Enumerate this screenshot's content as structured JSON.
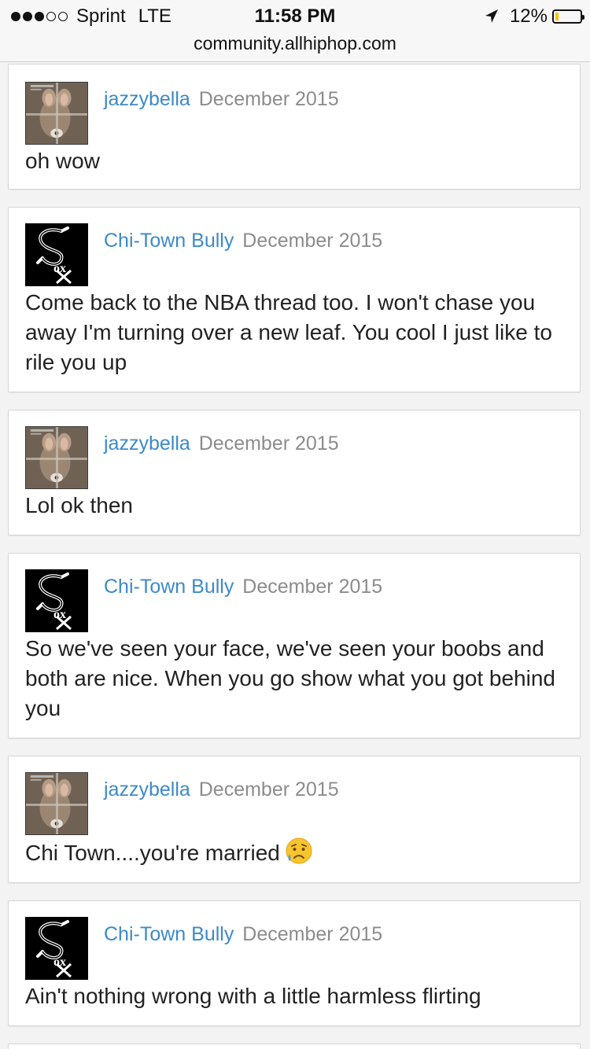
{
  "status_bar": {
    "carrier": "Sprint",
    "network": "LTE",
    "time": "11:58 PM",
    "battery_percent": "12%",
    "battery_level": 0.12,
    "signal_bars_filled": 3,
    "signal_bars_total": 5
  },
  "browser": {
    "url": "community.allhiphop.com"
  },
  "colors": {
    "author_link": "#3c8ac9",
    "date": "#8c8c8c",
    "battery": "#f5c400"
  },
  "posts": [
    {
      "author": "jazzybella",
      "date": "December 2015",
      "body": "oh wow",
      "avatar": "deer-photo-avatar"
    },
    {
      "author": "Chi-Town Bully",
      "date": "December 2015",
      "body": "Come back to the NBA thread too. I won't chase you away I'm turning over a new leaf. You cool I just like to rile you up",
      "avatar": "white-sox-logo-avatar"
    },
    {
      "author": "jazzybella",
      "date": "December 2015",
      "body": "Lol ok then",
      "avatar": "deer-photo-avatar"
    },
    {
      "author": "Chi-Town Bully",
      "date": "December 2015",
      "body": "So we've seen your face, we've seen your boobs and both are nice. When you go show what you got behind you",
      "avatar": "white-sox-logo-avatar"
    },
    {
      "author": "jazzybella",
      "date": "December 2015",
      "body": "Chi Town....you're married",
      "emoji": "disappointed-relieved-face-emoji",
      "avatar": "deer-photo-avatar"
    },
    {
      "author": "Chi-Town Bully",
      "date": "December 2015",
      "body": "Ain't nothing wrong with a little harmless flirting",
      "avatar": "white-sox-logo-avatar"
    }
  ]
}
